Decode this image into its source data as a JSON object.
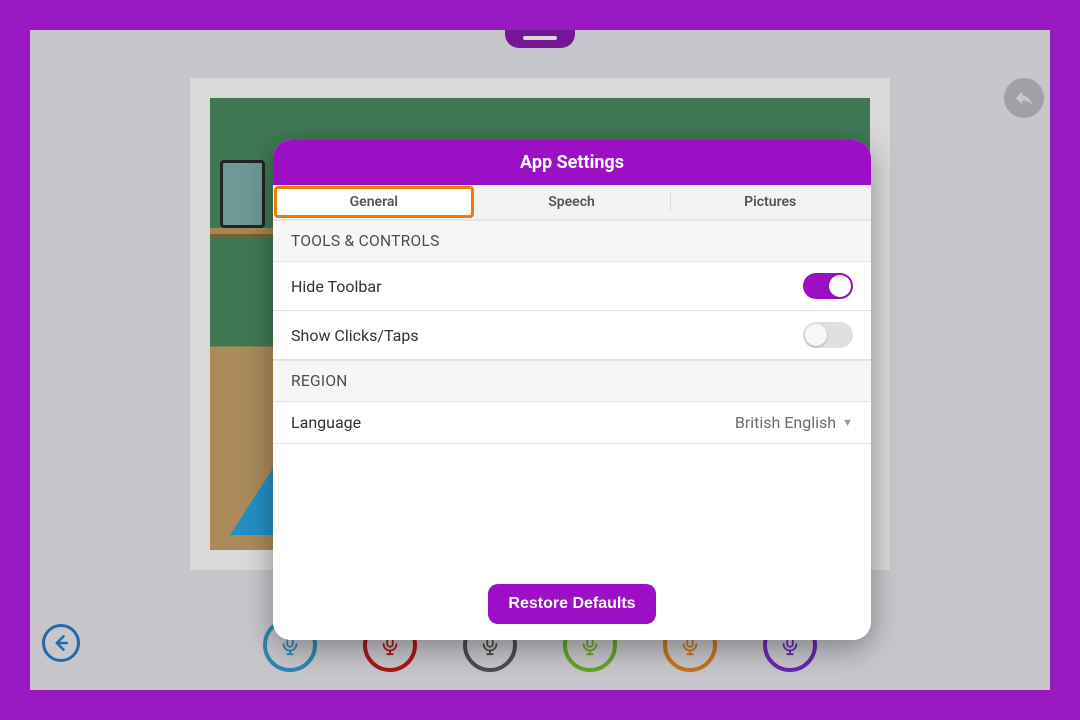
{
  "panel": {
    "title": "App Settings",
    "tabs": {
      "general": "General",
      "speech": "Speech",
      "pictures": "Pictures"
    },
    "sections": {
      "tools_controls": "TOOLS & CONTROLS",
      "region": "REGION"
    },
    "rows": {
      "hide_toolbar": {
        "label": "Hide Toolbar",
        "state": "on"
      },
      "show_clicks": {
        "label": "Show Clicks/Taps",
        "state": "off"
      },
      "language": {
        "label": "Language",
        "value": "British English"
      }
    },
    "restore": "Restore Defaults"
  },
  "mic_colors": [
    "#3a9dd1",
    "#c61d1d",
    "#5a5a5a",
    "#7abf2c",
    "#e38b1e",
    "#7c2ed1"
  ]
}
